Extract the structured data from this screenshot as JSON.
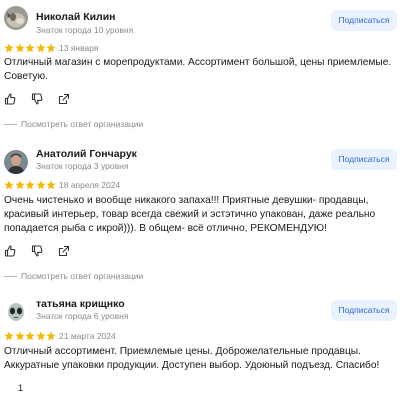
{
  "subscribe_label": "Подписаться",
  "org_reply_label": "Посмотреть ответ организации",
  "star_color": "#f5b800",
  "subscribe_bg": "#eaf2ff",
  "subscribe_text_color": "#2b6ad8",
  "reviews": [
    {
      "name": "Николай Килин",
      "level": "Знаток города 10 уровня",
      "rating": 5,
      "date": "13 января",
      "text": "Отличный магазин с морепродуктами. Ассортимент большой, цены приемлемые. Советую.",
      "avatar": "cat-photo-avatar"
    },
    {
      "name": "Анатолий Гончарук",
      "level": "Знаток города 3 уровня",
      "rating": 5,
      "date": "18 апреля 2024",
      "text": "Очень чистенько и вообще никакого запаха!!! Приятные девушки- продавцы, красивый интерьер, товар всегда свежий и эстэтично упакован, даже реально попадается рыба с икрой))). В общем- всё отлично, РЕКОМЕНДУЮ!",
      "avatar": "man-photo-avatar"
    },
    {
      "name": "татьяна крищнко",
      "level": "Знаток города 6 уровня",
      "rating": 5,
      "date": "21 марта 2024",
      "text": "Отличный ассортимент. Приемлемые цены. Доброжелательные продавцы. Аккуратные упаковки продукции. Доступен выбор. Удоюный подъезд. Спасибо!",
      "avatar": "alien-avatar"
    }
  ],
  "bottom_like_count": "1"
}
